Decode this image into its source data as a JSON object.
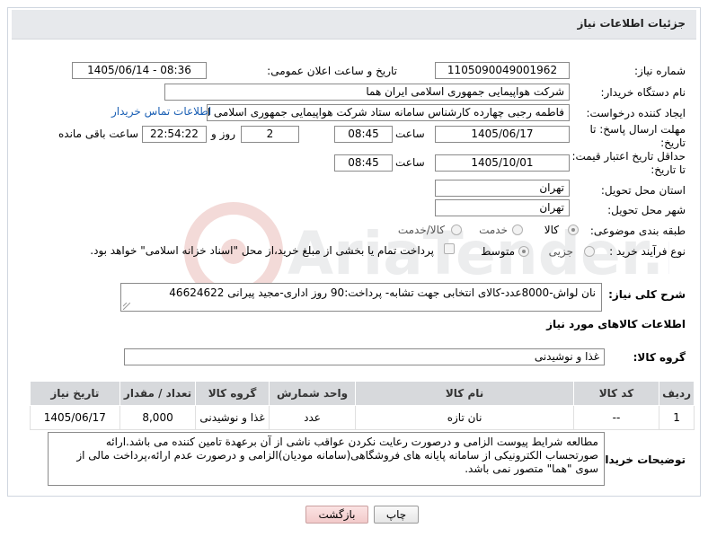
{
  "header": {
    "title": "جزئیات اطلاعات نیاز"
  },
  "labels": {
    "need_number": "شماره نیاز:",
    "announce_datetime": "تاریخ و ساعت اعلان عمومی:",
    "buyer_org": "نام دستگاه خریدار:",
    "requester": "ایجاد کننده درخواست:",
    "reply_deadline": "مهلت ارسال پاسخ: تا تاریخ:",
    "price_validity": "حداقل تاریخ اعتبار قیمت: تا تاریخ:",
    "delivery_province": "استان محل تحویل:",
    "delivery_city": "شهر محل تحویل:",
    "category": "طبقه بندی موضوعی:",
    "purchase_type": "نوع فرآیند خرید :",
    "time": "ساعت",
    "day_and": "روز و",
    "remaining": "ساعت باقی مانده",
    "time2": "ساعت",
    "description": "شرح کلی نیاز:",
    "goods_info": "اطلاعات کالاهای مورد نیاز",
    "goods_group": "گروه کالا:",
    "buyer_notes": "توضیحات خریدار:"
  },
  "values": {
    "need_number": "1105090049001962",
    "announce_datetime": "1405/06/14 - 08:36",
    "buyer_org": "شرکت هواپیمایی جمهوری اسلامی ایران هما",
    "requester": "فاطمه رجبی چهارده کارشناس سامانه ستاد شرکت هواپیمایی جمهوری اسلامی ایر",
    "buyer_contact_link": "اطلاعات تماس خریدار",
    "reply_date": "1405/06/17",
    "reply_time": "08:45",
    "reply_days": "2",
    "reply_remaining": "22:54:22",
    "validity_date": "1405/10/01",
    "validity_time": "08:45",
    "province": "تهران",
    "city": "تهران",
    "category_goods": "کالا",
    "category_service": "خدمت",
    "category_goods_service": "کالا/خدمت",
    "purchase_minor": "جزیی",
    "purchase_medium": "متوسط",
    "payment_note": "پرداخت تمام یا بخشی از مبلغ خرید،از محل \"اسناد خزانه اسلامی\" خواهد بود.",
    "description": "نان لواش-8000عدد-کالای انتخابی جهت تشابه- پرداخت:90 روز اداری-مجید پیرانی 46624622",
    "goods_group": "غذا و نوشیدنی",
    "buyer_notes": "مطالعه شرایط پیوست الزامی و درصورت رعایت نکردن عواقب ناشی از آن برعهدة تامین کننده می باشد.ارائه صورتحساب الکترونیکی از سامانه پایانه های فروشگاهی(سامانه مودیان)الزامی و درصورت عدم ارائه،پرداخت مالی از سوی \"هما\" متصور نمی باشد."
  },
  "table": {
    "headers": [
      "ردیف",
      "کد کالا",
      "نام کالا",
      "واحد شمارش",
      "گروه کالا",
      "تعداد / مقدار",
      "تاریخ نیاز"
    ],
    "rows": [
      [
        "1",
        "--",
        "نان تازه",
        "عدد",
        "غذا و نوشیدنی",
        "8,000",
        "1405/06/17"
      ]
    ]
  },
  "buttons": {
    "print": "چاپ",
    "back": "بازگشت"
  },
  "watermark": {
    "text": "AriaTender.net"
  },
  "colors": {
    "link": "#1a5fb4",
    "header_bg": "#e7e9ec",
    "table_header": "#d7d9dc",
    "back_button": "#f2caca"
  }
}
